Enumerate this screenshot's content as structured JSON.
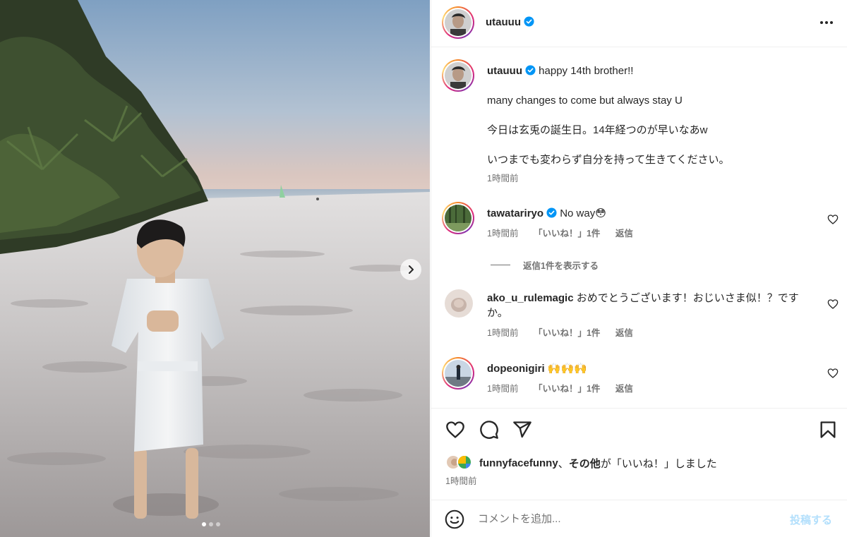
{
  "post": {
    "username": "utauuu",
    "verified": true,
    "carousel": {
      "slide_count": 3,
      "active_slide": 1
    }
  },
  "caption": {
    "username": "utauuu",
    "lines": [
      "happy 14th brother!!",
      "many changes to come but always stay U",
      "今日は玄兎の誕生日。14年経つのが早いなあw",
      "いつまでも変わらず自分を持って生きてください。"
    ],
    "time": "1時間前"
  },
  "comments": [
    {
      "username": "tawatariryo",
      "verified": true,
      "text": "No way😳",
      "time": "1時間前",
      "likes": "「いいね！」1件",
      "reply": "返信"
    },
    {
      "username": "ako_u_rulemagic",
      "verified": false,
      "text": "おめでとうございます！おじいさま似！？ですか。",
      "time": "1時間前",
      "likes": "「いいね！」1件",
      "reply": "返信"
    },
    {
      "username": "dopeonigiri",
      "verified": false,
      "text": "🙌🙌🙌",
      "time": "1時間前",
      "likes": "「いいね！」1件",
      "reply": "返信"
    }
  ],
  "view_replies": "返信1件を表示する",
  "likes_line": {
    "user": "funnyfacefunny",
    "sep": "、",
    "others": "その他",
    "suffix": "が「いいね！」しました"
  },
  "post_time": "1時間前",
  "add_comment": {
    "placeholder": "コメントを追加...",
    "post_label": "投稿する"
  },
  "colors": {
    "verified": "#0095f6",
    "muted": "#737373",
    "post_disabled": "#b2dffc"
  },
  "icons": [
    "verified-icon",
    "more-icon",
    "heart-icon",
    "comment-icon",
    "share-icon",
    "bookmark-icon",
    "emoji-icon",
    "chevron-right-icon"
  ]
}
